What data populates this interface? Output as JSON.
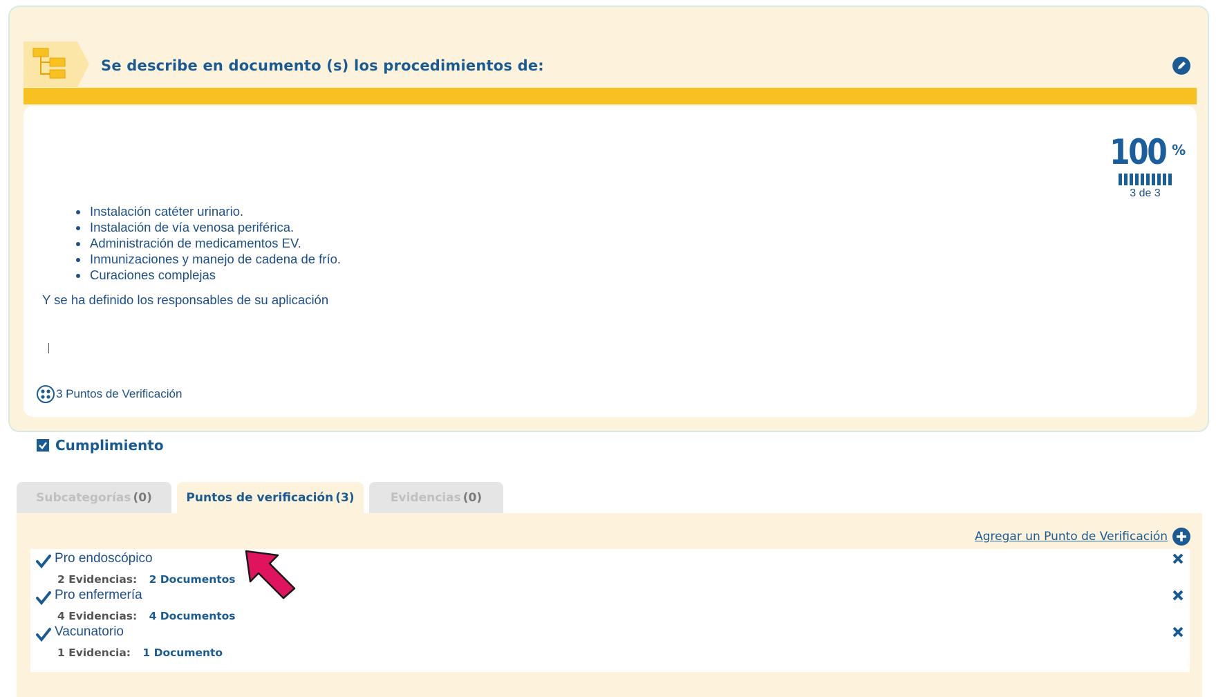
{
  "card": {
    "title": "Se describe en documento (s) los procedimientos de:",
    "description_items": [
      "Instalación catéter urinario.",
      "Instalación de vía venosa periférica.",
      "Administración de medicamentos EV.",
      "Inmunizaciones y manejo de cadena de frío.",
      "Curaciones complejas"
    ],
    "note": "Y se ha definido  los responsables de su aplicación",
    "verification_points_label": "3 Puntos de Verificación",
    "progress": {
      "percent_value": "100",
      "percent_sign": "%",
      "count_label": "3 de 3",
      "fraction": 1.0
    },
    "icons": {
      "header": "hierarchy-icon",
      "edit": "pencil-icon",
      "verification": "dots-circle-icon"
    }
  },
  "compliance": {
    "title": "Cumplimiento",
    "icon": "checkbox-icon"
  },
  "tabs": [
    {
      "label": "Subcategorías",
      "count": "(0)",
      "active": false
    },
    {
      "label": "Puntos de verificación",
      "count": "(3)",
      "active": true
    },
    {
      "label": "Evidencias",
      "count": "(0)",
      "active": false
    }
  ],
  "panel": {
    "add_label": "Agregar un Punto de Verificación",
    "items": [
      {
        "name": "Pro endoscópico",
        "evidence": "2 Evidencias:",
        "docs": "2 Documentos"
      },
      {
        "name": "Pro enfermería",
        "evidence": "4 Evidencias:",
        "docs": "4 Documentos"
      },
      {
        "name": "Vacunatorio",
        "evidence": "1 Evidencia:",
        "docs": "1 Documento"
      }
    ]
  },
  "colors": {
    "brand_blue": "#1a5b94",
    "card_bg": "#fdf3dc",
    "yellow_bar": "#f7c122",
    "annotation_arrow": "#e0145e"
  }
}
